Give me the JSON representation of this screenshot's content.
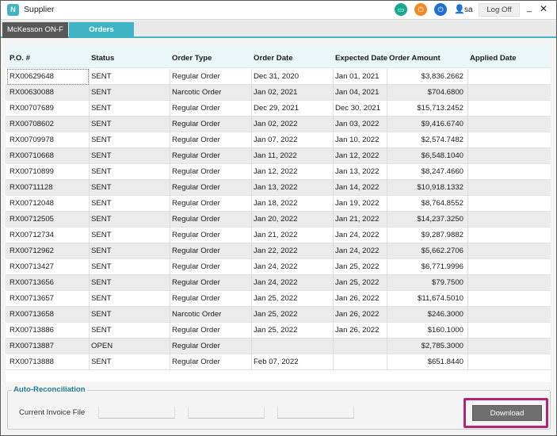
{
  "app": {
    "title": "Supplier",
    "icon_letter": "N"
  },
  "user": {
    "name": "sa"
  },
  "titlebar": {
    "logoff_label": "Log Off",
    "minimize": "_",
    "close": "✕"
  },
  "tabs": [
    {
      "label": "McKesson ON-F"
    },
    {
      "label": "Orders"
    }
  ],
  "columns": [
    "P.O. #",
    "Status",
    "Order Type",
    "Order Date",
    "Expected Date",
    "Order Amount",
    "Applied Date"
  ],
  "rows": [
    [
      "RX00629648",
      "SENT",
      "Regular Order",
      "Dec 31, 2020",
      "Jan 01, 2021",
      "$3,836.2662",
      ""
    ],
    [
      "RX00630088",
      "SENT",
      "Narcotic Order",
      "Jan 02, 2021",
      "Jan 04, 2021",
      "$704.6800",
      ""
    ],
    [
      "RX00707689",
      "SENT",
      "Regular Order",
      "Dec 29, 2021",
      "Dec 30, 2021",
      "$15,713.2452",
      ""
    ],
    [
      "RX00708602",
      "SENT",
      "Regular Order",
      "Jan 02, 2022",
      "Jan 03, 2022",
      "$9,416.6740",
      ""
    ],
    [
      "RX00709978",
      "SENT",
      "Regular Order",
      "Jan 07, 2022",
      "Jan 10, 2022",
      "$2,574.7482",
      ""
    ],
    [
      "RX00710668",
      "SENT",
      "Regular Order",
      "Jan 11, 2022",
      "Jan 12, 2022",
      "$6,548.1040",
      ""
    ],
    [
      "RX00710899",
      "SENT",
      "Regular Order",
      "Jan 12, 2022",
      "Jan 13, 2022",
      "$8,247.4660",
      ""
    ],
    [
      "RX00711128",
      "SENT",
      "Regular Order",
      "Jan 13, 2022",
      "Jan 14, 2022",
      "$10,918.1332",
      ""
    ],
    [
      "RX00712048",
      "SENT",
      "Regular Order",
      "Jan 18, 2022",
      "Jan 19, 2022",
      "$8,764.8552",
      ""
    ],
    [
      "RX00712505",
      "SENT",
      "Regular Order",
      "Jan 20, 2022",
      "Jan 21, 2022",
      "$14,237.3250",
      ""
    ],
    [
      "RX00712734",
      "SENT",
      "Regular Order",
      "Jan 21, 2022",
      "Jan 24, 2022",
      "$9,287.9882",
      ""
    ],
    [
      "RX00712962",
      "SENT",
      "Regular Order",
      "Jan 22, 2022",
      "Jan 24, 2022",
      "$5,662.2706",
      ""
    ],
    [
      "RX00713427",
      "SENT",
      "Regular Order",
      "Jan 24, 2022",
      "Jan 25, 2022",
      "$6,771.9996",
      ""
    ],
    [
      "RX00713656",
      "SENT",
      "Regular Order",
      "Jan 24, 2022",
      "Jan 25, 2022",
      "$79.7500",
      ""
    ],
    [
      "RX00713657",
      "SENT",
      "Regular Order",
      "Jan 25, 2022",
      "Jan 26, 2022",
      "$11,674.5010",
      ""
    ],
    [
      "RX00713658",
      "SENT",
      "Narcotic Order",
      "Jan 25, 2022",
      "Jan 26, 2022",
      "$246.3000",
      ""
    ],
    [
      "RX00713886",
      "SENT",
      "Regular Order",
      "Jan 25, 2022",
      "Jan 26, 2022",
      "$160.1000",
      ""
    ],
    [
      "RX00713887",
      "OPEN",
      "Regular Order",
      "",
      "",
      "$2,785.3000",
      ""
    ],
    [
      "RX00713888",
      "SENT",
      "Regular Order",
      "Feb 07, 2022",
      "",
      "$651.8440",
      ""
    ]
  ],
  "auto_reconciliation": {
    "title": "Auto-Reconciliation",
    "invoice_label": "Current Invoice File",
    "fields": [
      "",
      "",
      ""
    ],
    "download_label": "Download"
  },
  "colors": {
    "accent": "#3fb4c4",
    "highlight_frame": "#b2256f",
    "header_bg": "#eaf6f8"
  },
  "icons": [
    "monitor-icon",
    "power-icon",
    "logout-icon",
    "user-icon"
  ]
}
